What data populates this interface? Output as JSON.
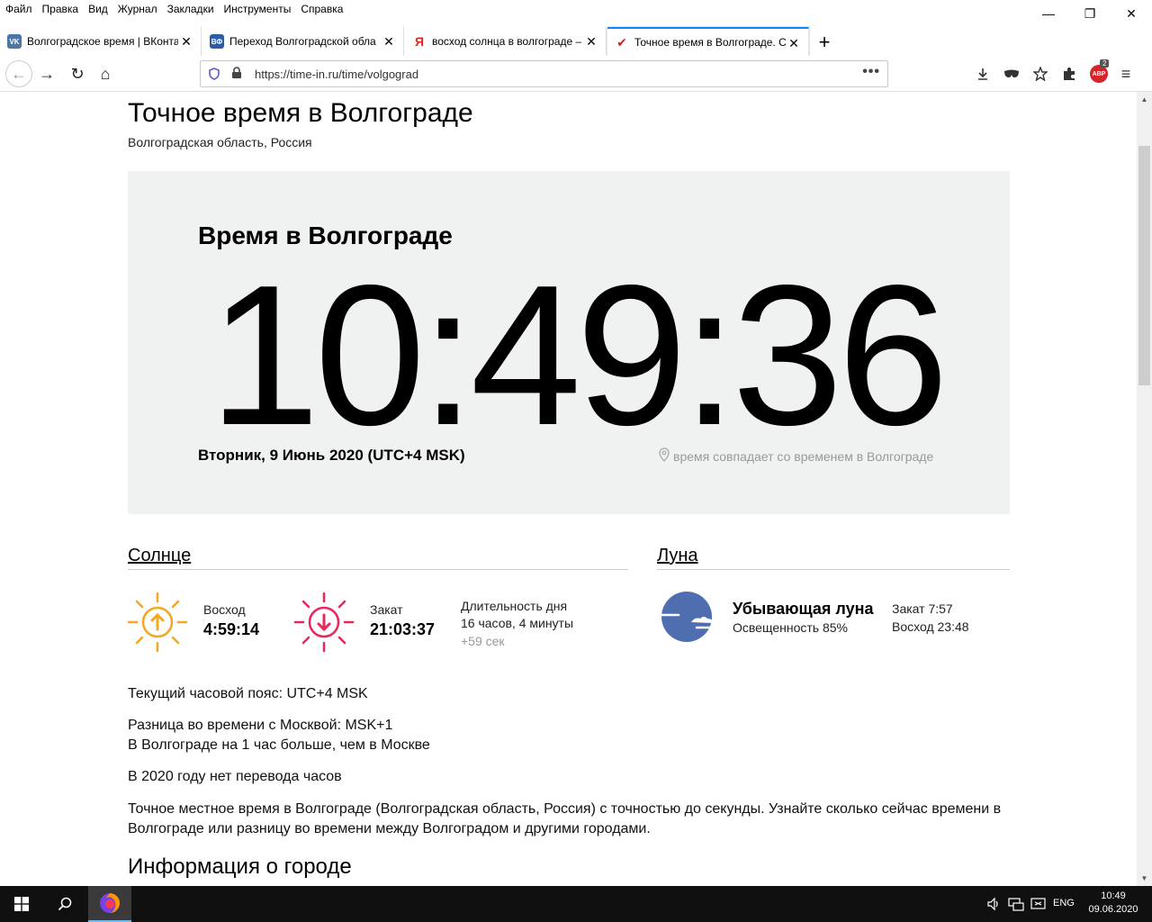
{
  "menu": [
    "Файл",
    "Правка",
    "Вид",
    "Журнал",
    "Закладки",
    "Инструменты",
    "Справка"
  ],
  "window_controls": {
    "minimize": "—",
    "maximize": "❐",
    "close": "✕"
  },
  "tabs": [
    {
      "title": "Волгоградское время | ВКонта",
      "favicon": "vk-icon",
      "favicon_text": "VK",
      "favicon_color": "#4a76a8",
      "active": false
    },
    {
      "title": "Переход Волгоградской обла",
      "favicon": "vf-icon",
      "favicon_text": "ВФ",
      "favicon_color": "#2a5ca8",
      "active": false
    },
    {
      "title": "восход солнца в волгограде –",
      "favicon": "yandex-icon",
      "favicon_text": "Я",
      "favicon_color": "#ffffff",
      "active": false
    },
    {
      "title": "Точное время в Волгограде. С",
      "favicon": "checkmark-icon",
      "favicon_text": "✔",
      "favicon_color": "#ffffff",
      "active": true
    }
  ],
  "newtab_label": "+",
  "navbar": {
    "back": "←",
    "forward": "→",
    "reload": "↻",
    "home": "⌂",
    "url": "https://time-in.ru/time/volgograd",
    "dots": "•••",
    "abp_text": "ABP",
    "abp_badge": "2"
  },
  "page": {
    "title": "Точное время в Волгограде",
    "subtitle": "Волгоградская область, Россия",
    "clock": {
      "heading": "Время в Волгограде",
      "time": "10:49:36",
      "date": "Вторник, 9 Июнь 2020 (UTC+4 MSK)",
      "note": "время совпадает со временем в Волгограде"
    },
    "sun": {
      "title": "Солнце",
      "sunrise_label": "Восход",
      "sunrise_time": "4:59:14",
      "sunset_label": "Закат",
      "sunset_time": "21:03:37",
      "day_length_label": "Длительность дня",
      "day_length_value": "16 часов, 4 минуты",
      "day_length_delta": "+59 сек",
      "sunrise_color": "#f5a623",
      "sunset_color": "#e8275a"
    },
    "moon": {
      "title": "Луна",
      "phase": "Убывающая луна",
      "illumination": "Освещенность 85%",
      "set": "Закат 7:57",
      "rise": "Восход 23:48",
      "color": "#4f6eb0"
    },
    "paragraphs": {
      "timezone": "Текущий часовой пояс: UTC+4 MSK",
      "diff1": "Разница во времени с Москвой: MSK+1",
      "diff2": "В Волгограде на 1 час больше, чем в Москве",
      "dst": "В 2020 году нет перевода часов",
      "desc": "Точное местное время в Волгограде (Волгоградская область, Россия) с точностью до секунды. Узнайте сколько сейчас времени в Волгограде или разницу во времени между Волгоградом и другими городами."
    },
    "city_heading": "Информация о городе"
  },
  "taskbar": {
    "lang": "ENG",
    "time": "10:49",
    "date": "09.06.2020"
  }
}
